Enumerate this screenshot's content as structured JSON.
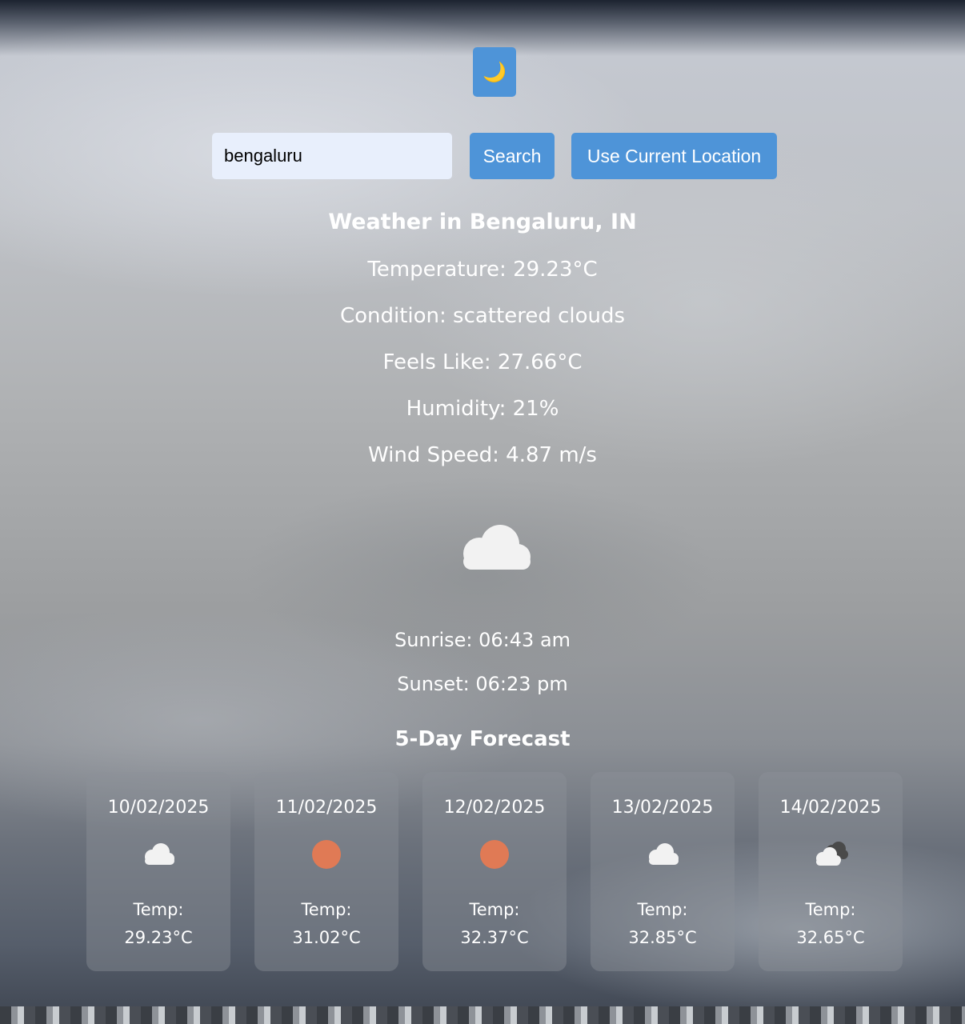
{
  "theme_toggle": {
    "icon": "crescent-moon-icon",
    "glyph": "🌙"
  },
  "search": {
    "value": "bengaluru",
    "search_label": "Search",
    "location_label": "Use Current Location"
  },
  "weather": {
    "title": "Weather in Bengaluru, IN",
    "temperature": "Temperature: 29.23°C",
    "condition": "Condition: scattered clouds",
    "feels_like": "Feels Like: 27.66°C",
    "humidity": "Humidity: 21%",
    "wind": "Wind Speed: 4.87 m/s",
    "icon": "cloud-icon",
    "sunrise": "Sunrise: 06:43 am",
    "sunset": "Sunset: 06:23 pm"
  },
  "forecast": {
    "title": "5-Day Forecast",
    "temp_label": "Temp:",
    "days": [
      {
        "date": "10/02/2025",
        "icon": "cloud-icon",
        "temp": "29.23°C"
      },
      {
        "date": "11/02/2025",
        "icon": "sun-icon",
        "temp": "31.02°C"
      },
      {
        "date": "12/02/2025",
        "icon": "sun-icon",
        "temp": "32.37°C"
      },
      {
        "date": "13/02/2025",
        "icon": "cloud-icon",
        "temp": "32.85°C"
      },
      {
        "date": "14/02/2025",
        "icon": "broken-clouds-icon",
        "temp": "32.65°C"
      }
    ]
  },
  "colors": {
    "button": "#4e94d8",
    "input_bg": "#e8effc",
    "sun": "#e07a55",
    "cloud": "#f2f2f2"
  }
}
